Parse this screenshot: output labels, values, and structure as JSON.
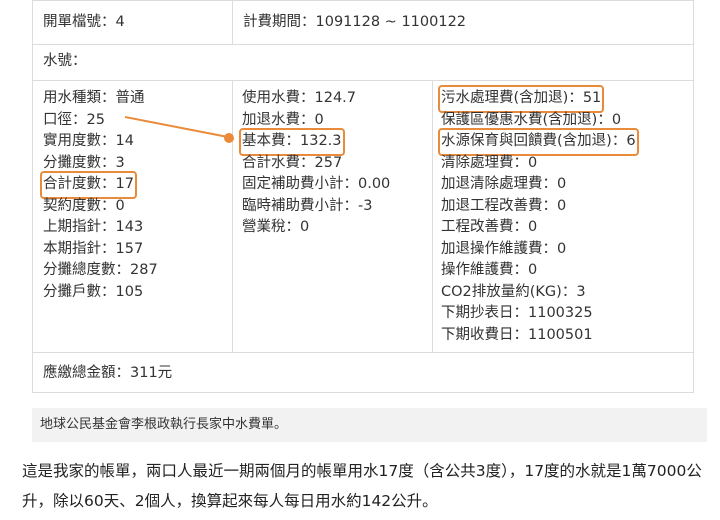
{
  "bill": {
    "account_no": "開單檔號：4",
    "billing_period": "計費期間：1091128 ~ 1100122",
    "water_no": "水號：",
    "col1": [
      "用水種類：普通",
      "口徑：25",
      "實用度數：14",
      "分攤度數：3",
      "合計度數：17",
      "契約度數：0",
      "上期指針：143",
      "本期指針：157",
      "分攤總度數：287",
      "分攤戶數：105"
    ],
    "col2": [
      "使用水費：124.7",
      "加退水費：0",
      "基本費：132.3",
      "合計水費：257",
      "固定補助費小計：0.00",
      "臨時補助費小計：-3",
      "營業稅：0"
    ],
    "col3": [
      "污水處理費(含加退)：51",
      "保護區優惠水費(含加退)：0",
      "水源保育與回饋費(含加退)：6",
      "清除處理費：0",
      "加退清除處理費：0",
      "加退工程改善費：0",
      "工程改善費：0",
      "加退操作維護費：0",
      "操作維護費：0",
      "CO2排放量約(KG)：3",
      "下期抄表日：1100325",
      "下期收費日：1100501"
    ],
    "total": "應繳總金額：311元"
  },
  "caption": "地球公民基金會李根政執行長家中水費單。",
  "paragraph": "這是我家的帳單，兩口人最近一期兩個月的帳單用水17度（含公共3度），17度的水就是1萬7000公升，除以60天、2個人，換算起來每人每日用水約142公升。",
  "highlight_color": "#e98b3a"
}
